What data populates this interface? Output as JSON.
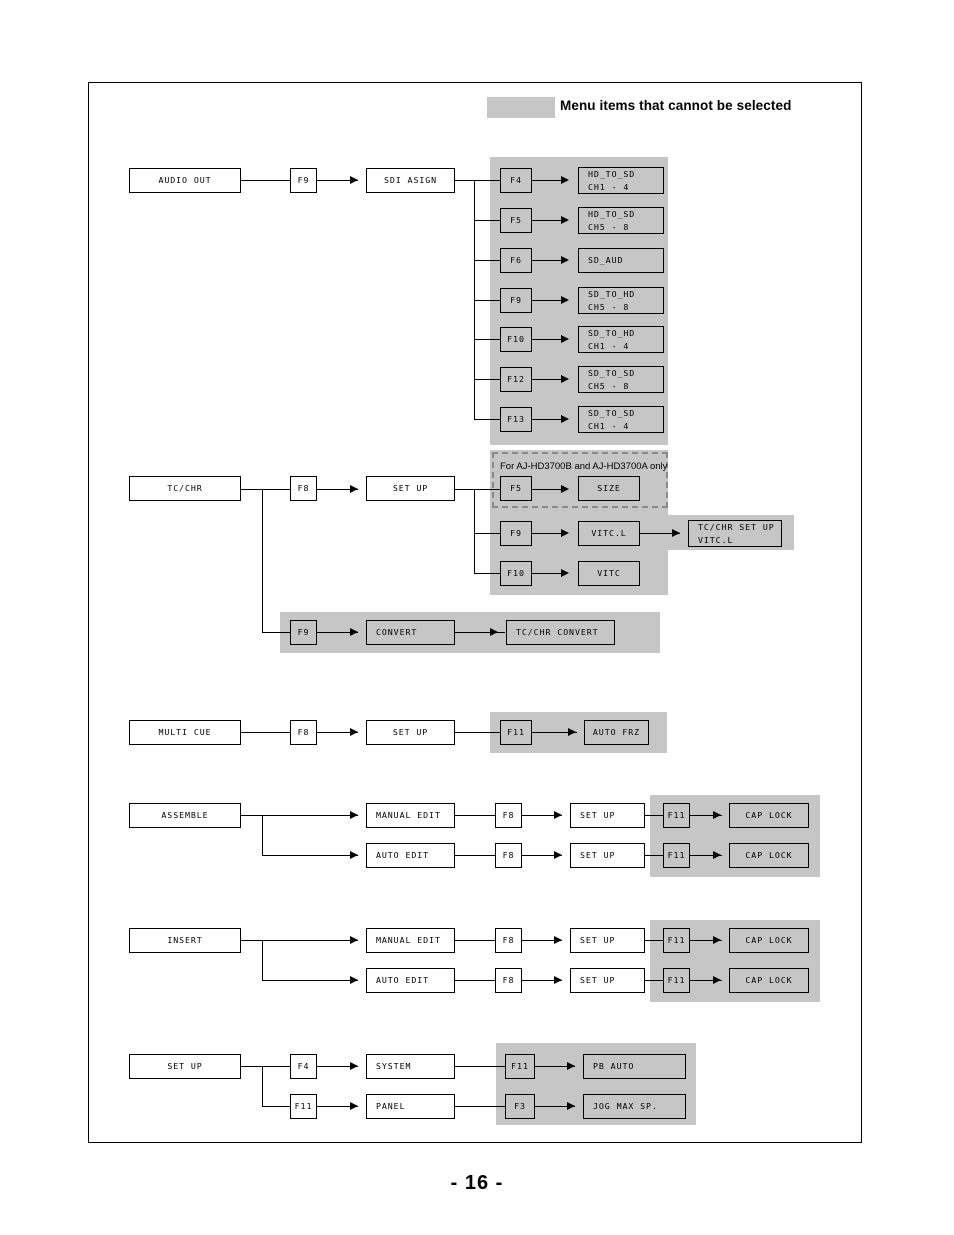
{
  "page": {
    "number": "- 16 -"
  },
  "legend": {
    "label": "Menu items that cannot be selected"
  },
  "note": {
    "model_restriction": "For AJ-HD3700B and AJ-HD3700A only"
  },
  "colors": {
    "disabled_fill": "#c6c6c6",
    "line": "#000000",
    "dashed_border": "#8a8a8a",
    "page_background": "#ffffff"
  },
  "sections": [
    {
      "id": "audio-out",
      "root": "AUDIO OUT",
      "key": "F9",
      "submenu": "SDI ASIGN",
      "branches": [
        {
          "key": "F4",
          "line1": "HD_TO_SD",
          "line2": "CH1 - 4"
        },
        {
          "key": "F5",
          "line1": "HD_TO_SD",
          "line2": "CH5 - 8"
        },
        {
          "key": "F6",
          "line1": "SD_AUD",
          "line2": ""
        },
        {
          "key": "F9",
          "line1": "SD_TO_HD",
          "line2": "CH5 - 8"
        },
        {
          "key": "F10",
          "line1": "SD_TO_HD",
          "line2": "CH1 - 4"
        },
        {
          "key": "F12",
          "line1": "SD_TO_SD",
          "line2": "CH5 - 8"
        },
        {
          "key": "F13",
          "line1": "SD_TO_SD",
          "line2": "CH1 - 4"
        }
      ]
    },
    {
      "id": "tc-chr",
      "root": "TC/CHR",
      "key": "F8",
      "submenu": "SET UP",
      "branches": [
        {
          "key": "F5",
          "item": "SIZE",
          "detail_line1": "",
          "detail_line2": ""
        },
        {
          "key": "F9",
          "item": "VITC.L",
          "detail_line1": "TC/CHR SET UP",
          "detail_line2": "VITC.L"
        },
        {
          "key": "F10",
          "item": "VITC",
          "detail_line1": "",
          "detail_line2": ""
        }
      ],
      "second_key": "F9",
      "second_submenu": "CONVERT",
      "second_detail": "TC/CHR CONVERT"
    },
    {
      "id": "multi-cue",
      "root": "MULTI CUE",
      "key": "F8",
      "submenu": "SET UP",
      "branch_key": "F11",
      "branch_item": "AUTO FRZ"
    },
    {
      "id": "assemble",
      "root": "ASSEMBLE",
      "rows": [
        {
          "mode": "MANUAL EDIT",
          "key": "F8",
          "submenu": "SET UP",
          "branch_key": "F11",
          "branch_item": "CAP LOCK"
        },
        {
          "mode": "AUTO EDIT",
          "key": "F8",
          "submenu": "SET UP",
          "branch_key": "F11",
          "branch_item": "CAP LOCK"
        }
      ]
    },
    {
      "id": "insert",
      "root": "INSERT",
      "rows": [
        {
          "mode": "MANUAL EDIT",
          "key": "F8",
          "submenu": "SET UP",
          "branch_key": "F11",
          "branch_item": "CAP LOCK"
        },
        {
          "mode": "AUTO EDIT",
          "key": "F8",
          "submenu": "SET UP",
          "branch_key": "F11",
          "branch_item": "CAP LOCK"
        }
      ]
    },
    {
      "id": "set-up",
      "root": "SET UP",
      "rows": [
        {
          "key": "F4",
          "submenu": "SYSTEM",
          "branch_key": "F11",
          "branch_item": "PB AUTO"
        },
        {
          "key": "F11",
          "submenu": "PANEL",
          "branch_key": "F3",
          "branch_item": "JOG MAX SP."
        }
      ]
    }
  ]
}
